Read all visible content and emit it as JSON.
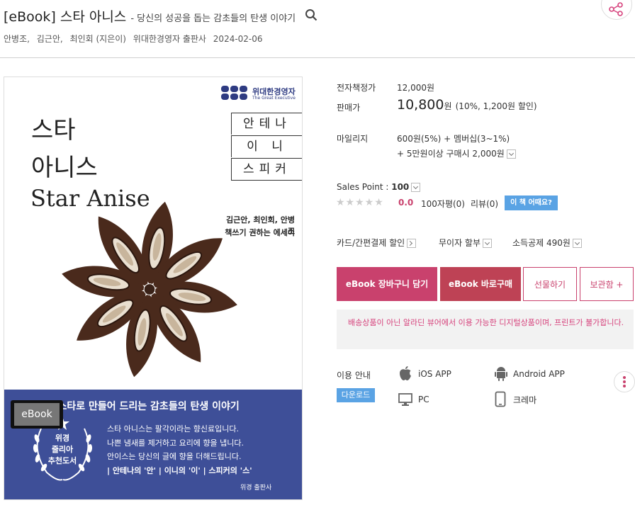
{
  "header": {
    "title": "[eBook] 스타 아니스",
    "subtitle": "- 당신의 성공을 돕는 감초들의 탄생 이야기",
    "authors": [
      "안병조,",
      "김근안,",
      "최인회 (지은이)"
    ],
    "publisher": "위대한경영자 출판사",
    "date": "2024-02-06"
  },
  "cover": {
    "logo": "위대한경영자",
    "logo_sub": "The Great Executive",
    "title_line1": "스타",
    "title_line2": "아니스",
    "title_en": "Star Anise",
    "boxes": [
      "안테나",
      "이 니",
      "스피커"
    ],
    "authors": "김근안, 최인회, 안병조",
    "tagline": "책쓰기 권하는 에세이",
    "band_headline": "당신을 스타로 만들어 드리는 감초들의 탄생 이야기",
    "band_lines": [
      "스타 아니스는 팔각이라는 향신료입니다.",
      "나쁜 냄새를 제거하고 요리에 향을 냅니다.",
      "안이스는 당신의 글에 향을 더해드립니다."
    ],
    "band_highlight": "| 안테나의 '안'   | 이니의 '이'   | 스피커의 '스'",
    "band_publisher": "위경 출판사",
    "wreath": [
      "위경",
      "줄리아",
      "추천도서"
    ],
    "badge": "eBook"
  },
  "info": {
    "list_price_label": "전자책정가",
    "list_price": "12,000원",
    "sale_label": "판매가",
    "sale_price": "10,800",
    "sale_unit": "원",
    "sale_discount": "(10%, 1,200원 할인)",
    "mileage_label": "마일리지",
    "mileage_line1": "600원(5%) + 멤버십(3~1%)",
    "mileage_line2": "+ 5만원이상 구매시 2,000원",
    "sales_point": "Sales Point : ",
    "sales_point_value": "100",
    "rating": "0.0",
    "reviews_100": "100자평(0)",
    "reviews": "리뷰(0)",
    "review_btn": "이 책 어때요?",
    "card_discount": "카드/간편결제 할인",
    "installment": "무이자 할부",
    "tax": "소득공제 490원"
  },
  "buttons": {
    "cart": "eBook 장바구니 담기",
    "buy": "eBook 바로구매",
    "gift": "선물하기",
    "save": "보관함 +"
  },
  "notice": "배송상품이 아닌 알라딘 뷰어에서 이용 가능한 디지털상품이며, 프린트가 불가합니다.",
  "usage": {
    "label": "이용 안내",
    "download": "다운로드",
    "ios": "iOS APP",
    "android": "Android APP",
    "pc": "PC",
    "crema": "크레마"
  },
  "colors": {
    "accent": "#c9416d",
    "buy": "#be4255",
    "info_blue": "#5aa3e4",
    "cover_band": "#3e4f98"
  }
}
